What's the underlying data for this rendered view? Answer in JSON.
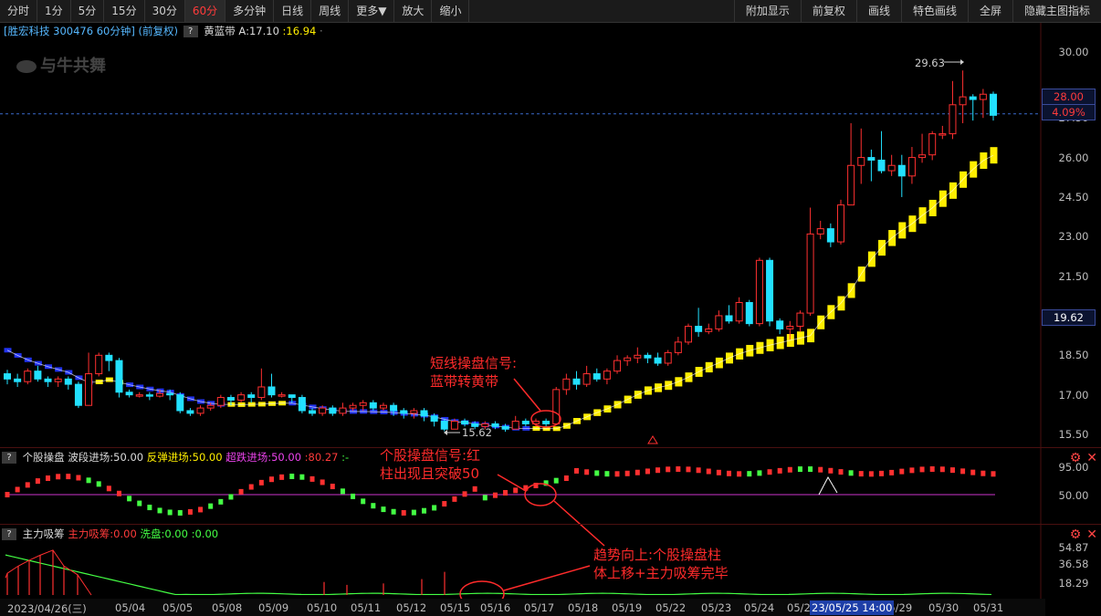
{
  "toolbar": {
    "left": [
      {
        "label": "分时",
        "active": false
      },
      {
        "label": "1分",
        "active": false
      },
      {
        "label": "5分",
        "active": false
      },
      {
        "label": "15分",
        "active": false
      },
      {
        "label": "30分",
        "active": false
      },
      {
        "label": "60分",
        "active": true
      },
      {
        "label": "多分钟",
        "active": false
      },
      {
        "label": "日线",
        "active": false
      },
      {
        "label": "周线",
        "active": false
      },
      {
        "label": "更多▼",
        "active": false
      },
      {
        "label": "放大",
        "active": false
      },
      {
        "label": "缩小",
        "active": false
      }
    ],
    "right": [
      "附加显示",
      "前复权",
      "画线",
      "特色画线",
      "全屏",
      "隐藏主图指标"
    ]
  },
  "main_info": {
    "stock": "[胜宏科技 300476 60分钟] (前复权)",
    "indicator_name": "黄蓝带",
    "a_label": "A:17.10",
    "b_value": ":16.94",
    "dots": "·"
  },
  "logo_text": "与牛共舞",
  "sub1": {
    "name": "个股操盘",
    "p1": "波段进场:50.00",
    "p2": "反弹进场:50.00",
    "p3": "超跌进场:50.00",
    "p4": ":80.27",
    "p5": ":-",
    "axis": [
      "95.00",
      "50.00"
    ]
  },
  "sub2": {
    "name": "主力吸筹",
    "p1": "主力吸筹:0.00",
    "p2": "洗盘:0.00",
    "p3": ":0.00",
    "axis": [
      "54.87",
      "36.58",
      "18.29"
    ]
  },
  "price_axis": [
    "30.00",
    "27.50",
    "26.00",
    "24.50",
    "23.00",
    "21.50",
    "18.50",
    "17.00",
    "15.50"
  ],
  "badges": {
    "price": "28.00",
    "pct": "4.09%",
    "level": "19.62"
  },
  "peak_label": "29.63",
  "low_label": "15.62",
  "annotations": {
    "a1": [
      "短线操盘信号:",
      "蓝带转黄带"
    ],
    "a2": [
      "个股操盘信号:红",
      "柱出现且突破50"
    ],
    "a3": [
      "趋势向上:个股操盘柱",
      "体上移+主力吸筹完毕"
    ]
  },
  "dates": [
    "2023/04/26(三)",
    "05/04",
    "05/05",
    "05/08",
    "05/09",
    "05/10",
    "05/11",
    "05/12",
    "05/15",
    "05/16",
    "05/17",
    "05/18",
    "05/19",
    "05/22",
    "05/23",
    "05/24",
    "05/2",
    "05/29",
    "05/30",
    "05/31"
  ],
  "date_highlight": "23/05/25 14:00",
  "colors": {
    "up": "#ff3030",
    "down": "#22e0ff",
    "yellow": "#ffee00",
    "blue": "#2233ee",
    "green": "#44ff44",
    "magenta": "#cc33cc",
    "annot": "#ff2b2b"
  },
  "chart_data": {
    "type": "candlestick",
    "interval": "60分钟",
    "ylim": [
      15.0,
      30.6
    ],
    "candles": [
      [
        17.8,
        17.6,
        17.95,
        17.4
      ],
      [
        17.6,
        17.5,
        17.8,
        17.3
      ],
      [
        17.5,
        17.9,
        18.0,
        17.4
      ],
      [
        17.9,
        17.6,
        18.1,
        17.5
      ],
      [
        17.6,
        17.5,
        17.7,
        17.3
      ],
      [
        17.5,
        17.6,
        17.7,
        17.3
      ],
      [
        17.6,
        17.4,
        17.7,
        17.2
      ],
      [
        17.4,
        16.6,
        17.5,
        16.5
      ],
      [
        16.6,
        17.8,
        18.6,
        16.6
      ],
      [
        17.8,
        18.5,
        18.6,
        17.7
      ],
      [
        18.5,
        18.3,
        18.6,
        17.9
      ],
      [
        18.3,
        17.1,
        18.4,
        16.9
      ],
      [
        17.1,
        17.0,
        17.2,
        16.9
      ],
      [
        17.0,
        17.0,
        17.1,
        16.9
      ],
      [
        17.0,
        16.95,
        17.1,
        16.8
      ],
      [
        16.95,
        17.05,
        17.2,
        16.9
      ],
      [
        17.05,
        17.0,
        17.2,
        16.8
      ],
      [
        17.0,
        16.4,
        17.1,
        16.3
      ],
      [
        16.4,
        16.3,
        16.5,
        16.2
      ],
      [
        16.3,
        16.5,
        16.6,
        16.2
      ],
      [
        16.5,
        16.6,
        16.7,
        16.4
      ],
      [
        16.6,
        16.9,
        17.0,
        16.5
      ],
      [
        16.9,
        16.8,
        17.0,
        16.6
      ],
      [
        16.8,
        17.0,
        17.1,
        16.7
      ],
      [
        17.0,
        16.9,
        17.1,
        16.7
      ],
      [
        16.9,
        17.3,
        18.0,
        16.8
      ],
      [
        17.3,
        17.0,
        17.8,
        16.9
      ],
      [
        17.0,
        17.0,
        17.1,
        16.9
      ],
      [
        17.0,
        16.9,
        17.0,
        16.7
      ],
      [
        16.9,
        16.4,
        17.0,
        16.3
      ],
      [
        16.4,
        16.3,
        16.5,
        16.2
      ],
      [
        16.3,
        16.5,
        16.6,
        16.2
      ],
      [
        16.5,
        16.3,
        16.6,
        16.2
      ],
      [
        16.3,
        16.5,
        16.7,
        16.2
      ],
      [
        16.5,
        16.6,
        16.7,
        16.4
      ],
      [
        16.6,
        16.7,
        16.8,
        16.4
      ],
      [
        16.7,
        16.5,
        16.8,
        16.4
      ],
      [
        16.5,
        16.6,
        16.7,
        16.4
      ],
      [
        16.6,
        16.4,
        16.7,
        16.2
      ],
      [
        16.4,
        16.3,
        16.5,
        16.1
      ],
      [
        16.3,
        16.4,
        16.5,
        16.1
      ],
      [
        16.4,
        16.2,
        16.5,
        16.0
      ],
      [
        16.2,
        16.0,
        16.3,
        15.8
      ],
      [
        16.0,
        15.7,
        16.1,
        15.62
      ],
      [
        15.7,
        16.0,
        16.1,
        15.7
      ],
      [
        16.0,
        15.9,
        16.1,
        15.8
      ],
      [
        15.9,
        15.8,
        16.0,
        15.7
      ],
      [
        15.8,
        15.9,
        16.0,
        15.7
      ],
      [
        15.9,
        15.8,
        16.0,
        15.7
      ],
      [
        15.8,
        15.7,
        15.9,
        15.6
      ],
      [
        15.7,
        16.0,
        16.2,
        15.7
      ],
      [
        16.0,
        15.9,
        16.1,
        15.8
      ],
      [
        15.9,
        16.0,
        16.1,
        15.8
      ],
      [
        16.0,
        15.9,
        16.1,
        15.8
      ],
      [
        15.9,
        17.2,
        17.3,
        15.9
      ],
      [
        17.2,
        17.6,
        17.8,
        17.0
      ],
      [
        17.6,
        17.4,
        17.9,
        17.2
      ],
      [
        17.4,
        17.8,
        18.1,
        17.3
      ],
      [
        17.8,
        17.6,
        18.0,
        17.5
      ],
      [
        17.6,
        17.9,
        18.0,
        17.4
      ],
      [
        17.9,
        18.3,
        18.5,
        17.8
      ],
      [
        18.3,
        18.4,
        18.5,
        18.1
      ],
      [
        18.4,
        18.5,
        18.8,
        18.2
      ],
      [
        18.5,
        18.4,
        18.6,
        18.2
      ],
      [
        18.4,
        18.2,
        18.6,
        18.1
      ],
      [
        18.2,
        18.6,
        18.7,
        18.1
      ],
      [
        18.6,
        19.0,
        19.2,
        18.5
      ],
      [
        19.0,
        19.6,
        19.7,
        18.9
      ],
      [
        19.6,
        19.4,
        20.3,
        19.2
      ],
      [
        19.4,
        19.5,
        19.7,
        19.3
      ],
      [
        19.5,
        20.0,
        20.2,
        19.4
      ],
      [
        20.0,
        19.8,
        20.4,
        19.7
      ],
      [
        19.8,
        20.5,
        20.7,
        19.7
      ],
      [
        20.5,
        19.7,
        20.6,
        19.6
      ],
      [
        19.7,
        22.1,
        22.2,
        19.6
      ],
      [
        22.1,
        19.8,
        22.2,
        19.6
      ],
      [
        19.8,
        19.5,
        19.9,
        19.3
      ],
      [
        19.5,
        19.6,
        19.8,
        19.1
      ],
      [
        19.6,
        20.1,
        20.2,
        19.4
      ],
      [
        20.1,
        23.1,
        24.1,
        20.0
      ],
      [
        23.1,
        23.3,
        23.6,
        22.9
      ],
      [
        23.3,
        22.8,
        23.5,
        22.6
      ],
      [
        22.8,
        24.2,
        24.4,
        22.7
      ],
      [
        24.2,
        25.7,
        27.3,
        24.7
      ],
      [
        25.7,
        26.0,
        27.1,
        25.0
      ],
      [
        26.0,
        25.9,
        26.3,
        25.1
      ],
      [
        25.9,
        25.5,
        27.0,
        25.4
      ],
      [
        25.5,
        25.7,
        26.1,
        25.3
      ],
      [
        25.7,
        25.3,
        26.1,
        24.5
      ],
      [
        25.3,
        26.0,
        26.4,
        25.0
      ],
      [
        26.0,
        26.1,
        26.9,
        25.8
      ],
      [
        26.1,
        26.9,
        27.0,
        25.9
      ],
      [
        26.9,
        26.9,
        27.2,
        26.7
      ],
      [
        26.9,
        28.0,
        28.9,
        26.7
      ],
      [
        28.0,
        28.3,
        29.3,
        27.3
      ],
      [
        28.3,
        28.2,
        28.4,
        27.4
      ],
      [
        28.2,
        28.4,
        28.6,
        27.5
      ],
      [
        28.4,
        27.6,
        28.5,
        27.4
      ]
    ]
  }
}
